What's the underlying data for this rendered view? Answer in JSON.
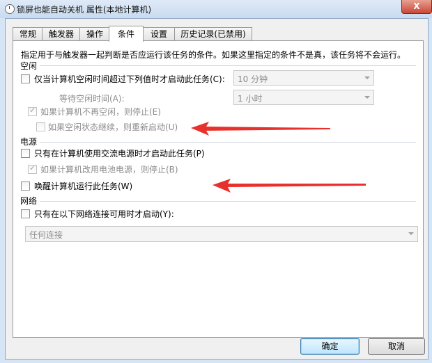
{
  "window": {
    "title": "锁屏也能自动关机 属性(本地计算机)",
    "close_label": "X"
  },
  "tabs": [
    {
      "label": "常规"
    },
    {
      "label": "触发器"
    },
    {
      "label": "操作"
    },
    {
      "label": "条件"
    },
    {
      "label": "设置"
    },
    {
      "label": "历史记录(已禁用)"
    }
  ],
  "active_tab": "条件",
  "description": "指定用于与触发器一起判断是否应运行该任务的条件。如果这里指定的条件不是真，该任务将不会运行。",
  "idle": {
    "section_label": "空闲",
    "start_if_idle_label": "仅当计算机空闲时间超过下列值时才启动此任务(C):",
    "start_if_idle_checked": false,
    "idle_duration_value": "10 分钟",
    "wait_label": "等待空闲时间(A):",
    "wait_value": "1 小时",
    "stop_if_not_idle_label": "如果计算机不再空闲，则停止(E)",
    "stop_if_not_idle_checked": true,
    "restart_if_idle_label": "如果空闲状态继续，则重新启动(U)",
    "restart_if_idle_checked": false
  },
  "power": {
    "section_label": "电源",
    "ac_only_label": "只有在计算机使用交流电源时才启动此任务(P)",
    "ac_only_checked": false,
    "stop_on_battery_label": "如果计算机改用电池电源，则停止(B)",
    "stop_on_battery_checked": true,
    "wake_label": "唤醒计算机运行此任务(W)",
    "wake_checked": false
  },
  "network": {
    "section_label": "网络",
    "only_if_network_label": "只有在以下网络连接可用时才启动(Y):",
    "only_if_network_checked": false,
    "connection_value": "任何连接"
  },
  "buttons": {
    "ok_label": "确定",
    "cancel_label": "取消"
  },
  "colors": {
    "annotation_arrow": "#e8312c",
    "title_bar": "#c9dbef",
    "close_button": "#c9483a"
  }
}
